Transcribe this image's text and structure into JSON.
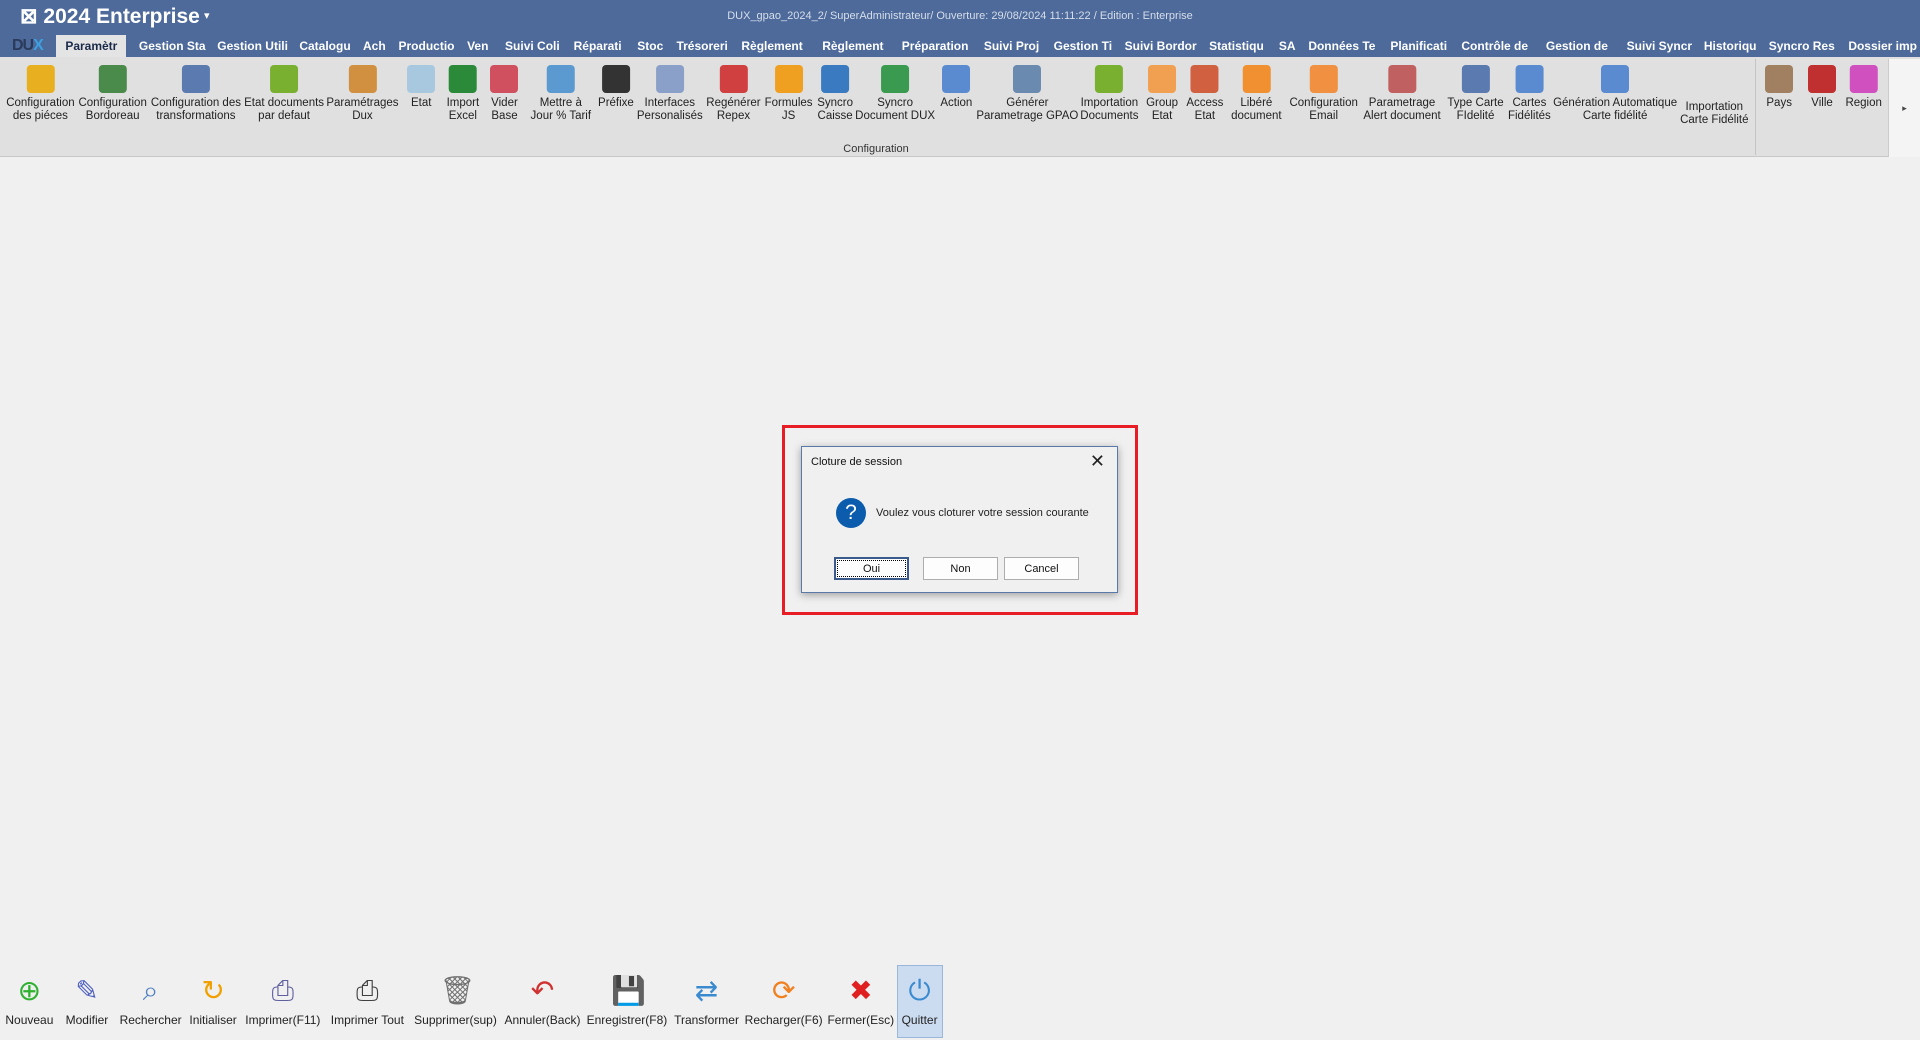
{
  "app": {
    "title": "⊠ 2024  Enterprise",
    "caret": "▾",
    "session": "DUX_gpao_2024_2/ SuperAdministrateur/ Ouverture: 29/08/2024 11:11:22 / Edition : Enterprise",
    "logo_a": "DU",
    "logo_b": "X"
  },
  "tabs": [
    "Paramètr",
    "Gestion Sta",
    "Gestion Utili",
    "Catalogu",
    "Ach",
    "Productio",
    "Ven",
    "Suivi Coli",
    "Réparati",
    "Stoc",
    "Trésoreri",
    "Règlement",
    "Règlement",
    "Préparation",
    "Suivi Proj",
    "Gestion Ti",
    "Suivi Bordor",
    "Statistiqu",
    "SA",
    "Données Te",
    "Planificati",
    "Contrôle de",
    "Gestion de",
    "Suivi Syncr",
    "Historiqu",
    "Syncro Res",
    "Dossier imp"
  ],
  "ribbon": {
    "group_label": "Configuration",
    "scroll_icon": "▸",
    "items": [
      {
        "label": "Configuration\ndes piéces",
        "icon": "box-icon",
        "color": "#e8b020"
      },
      {
        "label": "Configuration\nBordoreau",
        "icon": "grid-icon",
        "color": "#4a8a4a"
      },
      {
        "label": "Configuration des\ntransformations",
        "icon": "sort-icon",
        "color": "#5a7ab0"
      },
      {
        "label": "Etat documents\npar defaut",
        "icon": "flag-icon",
        "color": "#7ab030"
      },
      {
        "label": "Paramétrages\nDux",
        "icon": "spell-icon",
        "color": "#d09040"
      },
      {
        "label": "Etat",
        "icon": "doc-icon",
        "color": "#a8c8e0"
      },
      {
        "label": "Import\nExcel",
        "icon": "excel-icon",
        "color": "#2a8a3a"
      },
      {
        "label": "Vider\nBase",
        "icon": "eraser-icon",
        "color": "#d05060"
      },
      {
        "label": "Mettre à\nJour % Tarif",
        "icon": "refresh-icon",
        "color": "#5a9ad0"
      },
      {
        "label": "Préfixe",
        "icon": "ab-icon",
        "color": "#333333"
      },
      {
        "label": "Interfaces\nPersonalisés",
        "icon": "chart-icon",
        "color": "#8aa0c8"
      },
      {
        "label": "Regénérer\nRepex",
        "icon": "chart-clock-icon",
        "color": "#d04040"
      },
      {
        "label": "Formules\nJS",
        "icon": "sigma-icon",
        "color": "#f0a020"
      },
      {
        "label": "Syncro\nCaisse",
        "icon": "history-icon",
        "color": "#3a7ac0"
      },
      {
        "label": "Syncro\nDocument DUX",
        "icon": "copy-icon",
        "color": "#3a9a50"
      },
      {
        "label": "Action",
        "icon": "table-star-icon",
        "color": "#5a8ad0"
      },
      {
        "label": "Générer\nParametrage GPAO",
        "icon": "calendar-timer-icon",
        "color": "#6a8ab0"
      },
      {
        "label": "Importation\nDocuments",
        "icon": "download-icon",
        "color": "#7ab030"
      },
      {
        "label": "Group\nEtat",
        "icon": "folder-icon",
        "color": "#f0a050"
      },
      {
        "label": "Access\nEtat",
        "icon": "network-icon",
        "color": "#d06040"
      },
      {
        "label": "Libéré\ndocument",
        "icon": "database-icon",
        "color": "#f09030"
      },
      {
        "label": "Configuration\nEmail",
        "icon": "email-icon",
        "color": "#f09040"
      },
      {
        "label": "Parametrage\nAlert document",
        "icon": "settings-table-icon",
        "color": "#c06060"
      },
      {
        "label": "Type Carte\nFIdelité",
        "icon": "id-edit-icon",
        "color": "#5a7ab0"
      },
      {
        "label": "Cartes\nFidélités",
        "icon": "doc-add-icon",
        "color": "#5a8ad0"
      },
      {
        "label": "Génération Automatique\nCarte fidélité",
        "icon": "contact-card-icon",
        "color": "#5a8ad0"
      },
      {
        "label": "Importation\nCarte Fidélité",
        "icon": "",
        "color": ""
      },
      {
        "label": "Pays",
        "icon": "house-icon",
        "color": "#a08060"
      },
      {
        "label": "Ville",
        "icon": "house-red-icon",
        "color": "#c03030"
      },
      {
        "label": "Region",
        "icon": "palette-icon",
        "color": "#d050c0"
      }
    ]
  },
  "dialog": {
    "title": "Cloture de session",
    "close": "✕",
    "icon": "?",
    "message": "Voulez vous cloturer votre session courante",
    "buttons": [
      "Oui",
      "Non",
      "Cancel"
    ],
    "highlight_color": "#e81c24"
  },
  "bottom": [
    {
      "label": "Nouveau",
      "icon": "plus-circle-icon",
      "glyph": "⊕",
      "color": "#30b030"
    },
    {
      "label": "Modifier",
      "icon": "edit-icon",
      "glyph": "✎",
      "color": "#5060c0"
    },
    {
      "label": "Rechercher",
      "icon": "search-icon",
      "glyph": "⌕",
      "color": "#5080c0"
    },
    {
      "label": "Initialiser",
      "icon": "reset-icon",
      "glyph": "↻",
      "color": "#f0a000"
    },
    {
      "label": "Imprimer(F11)",
      "icon": "print-icon",
      "glyph": "⎙",
      "color": "#6060a0"
    },
    {
      "label": "Imprimer Tout",
      "icon": "printer-icon",
      "glyph": "⎙",
      "color": "#404040"
    },
    {
      "label": "Supprimer(sup)",
      "icon": "trash-icon",
      "glyph": "🗑",
      "color": "#707070"
    },
    {
      "label": "Annuler(Back)",
      "icon": "undo-icon",
      "glyph": "↶",
      "color": "#d03030"
    },
    {
      "label": "Enregistrer(F8)",
      "icon": "save-icon",
      "glyph": "💾",
      "color": "#40a040"
    },
    {
      "label": "Transformer",
      "icon": "transform-icon",
      "glyph": "⇄",
      "color": "#3a8ad0"
    },
    {
      "label": "Recharger(F6)",
      "icon": "reload-icon",
      "glyph": "⟳",
      "color": "#f08020"
    },
    {
      "label": "Fermer(Esc)",
      "icon": "close-icon",
      "glyph": "✖",
      "color": "#e02020"
    },
    {
      "label": "Quitter",
      "icon": "power-icon",
      "glyph": "⏻",
      "color": "#3a8ad0"
    }
  ]
}
